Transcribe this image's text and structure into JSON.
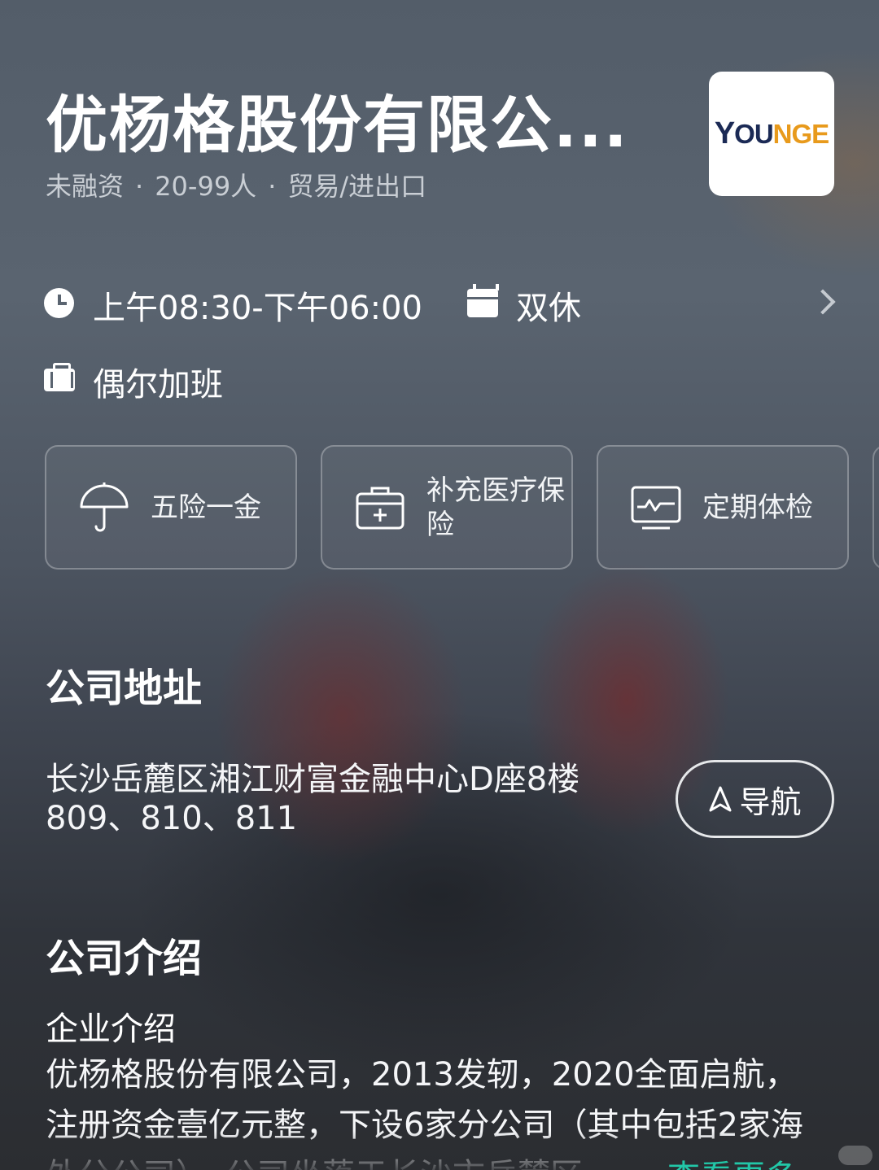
{
  "company": {
    "name": "优杨格股份有限公...",
    "funding": "未融资",
    "size": "20-99人",
    "industry": "贸易/进出口",
    "separator": "·",
    "logo_text_y": "Y",
    "logo_text_o": "OU",
    "logo_text_rest": "NGE"
  },
  "work": {
    "hours": "上午08:30-下午06:00",
    "rest": "双休",
    "overtime": "偶尔加班"
  },
  "benefits": [
    {
      "label": "五险一金",
      "icon": "umbrella-icon"
    },
    {
      "label": "补充医疗保险",
      "icon": "medical-kit-icon"
    },
    {
      "label": "定期体检",
      "icon": "monitor-pulse-icon"
    }
  ],
  "address": {
    "title": "公司地址",
    "text": "长沙岳麓区湘江财富金融中心D座8楼809、810、811",
    "nav_label": "导航"
  },
  "intro": {
    "title": "公司介绍",
    "subtitle": "企业介绍",
    "body": "优杨格股份有限公司，2013发轫，2020全面启航，注册资金壹亿元整，下设6家分公司（其中包括2家海外分公司），公司坐落于长沙市岳麓区",
    "see_more": "查看更多"
  },
  "colors": {
    "accent": "#22c7a8",
    "logo_navy": "#1b2a55",
    "logo_orange": "#e89a1c"
  }
}
